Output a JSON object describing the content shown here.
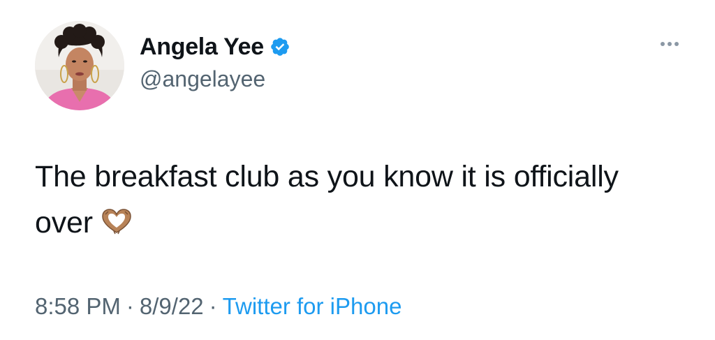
{
  "author": {
    "display_name": "Angela Yee",
    "handle": "@angelayee",
    "verified": true,
    "avatar_icon": "profile-photo-avatar"
  },
  "tweet": {
    "text": "The breakfast club as you know it is officially over",
    "emoji": "heart-hands-emoji"
  },
  "meta": {
    "time": "8:58 PM",
    "separator": "·",
    "date": "8/9/22",
    "source": "Twitter for iPhone"
  },
  "menu": {
    "icon": "more-options-icon"
  },
  "colors": {
    "text": "#0f1419",
    "secondary": "#536471",
    "link": "#1d9bf0",
    "verified": "#1d9bf0"
  }
}
